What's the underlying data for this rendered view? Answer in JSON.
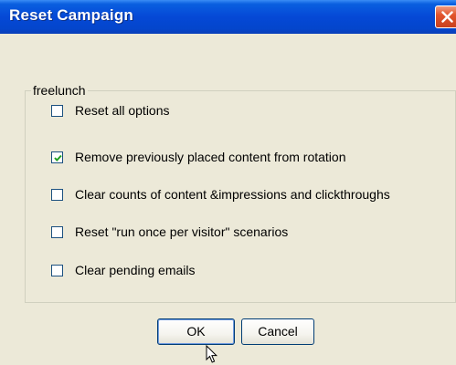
{
  "dialog": {
    "title": "Reset Campaign",
    "close_icon": "close-icon"
  },
  "group": {
    "label": "freelunch",
    "options": [
      {
        "label": "Reset all options",
        "checked": false
      },
      {
        "label": "Remove previously placed content from rotation",
        "checked": true
      },
      {
        "label": "Clear counts of content &impressions and clickthroughs",
        "checked": false
      },
      {
        "label": "Reset \"run once per visitor\" scenarios",
        "checked": false
      },
      {
        "label": "Clear pending emails",
        "checked": false
      }
    ]
  },
  "buttons": {
    "ok": "OK",
    "cancel": "Cancel"
  },
  "colors": {
    "titlebar": "#0548d6",
    "dialog_bg": "#ece9d8",
    "close_button": "#e2552e"
  }
}
